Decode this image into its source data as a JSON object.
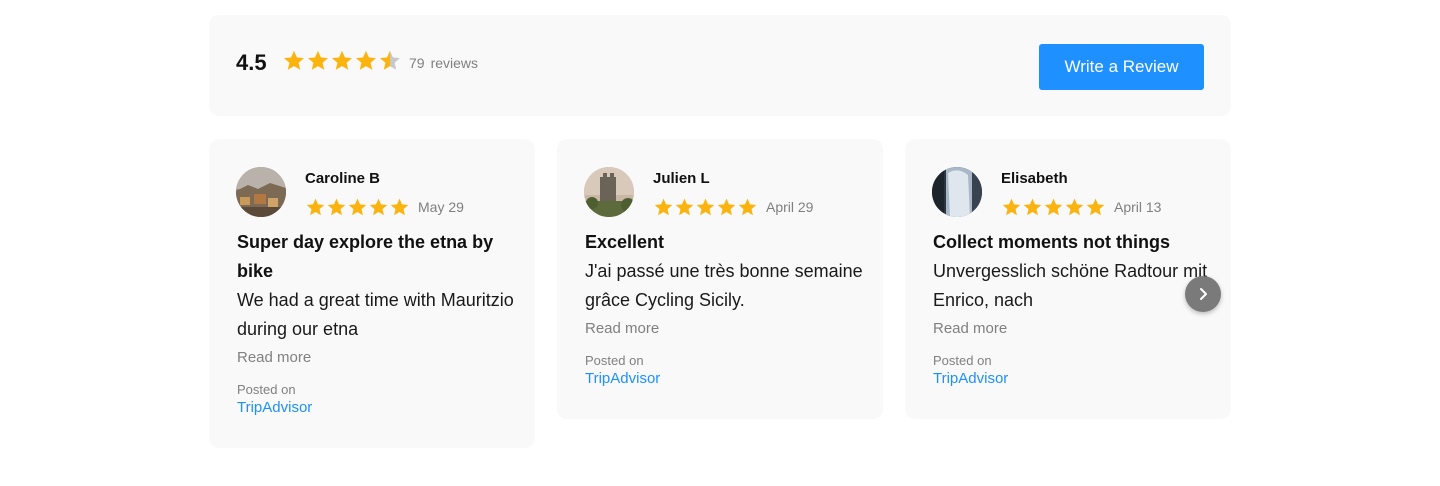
{
  "summary": {
    "average": "4.5",
    "rating_value": 4.5,
    "rating_max": 5,
    "review_count": "79",
    "reviews_label": "reviews",
    "write_button": "Write a Review"
  },
  "colors": {
    "star": "#fbb40f",
    "star_empty": "#c8c8c8",
    "accent": "#1e90ff",
    "card_bg": "#f9f9f9"
  },
  "reviews": [
    {
      "name": "Caroline B",
      "rating": 5,
      "date": "May 29",
      "title": "Super day explore the etna by bike",
      "text": "We had a great time with Mauritzio during our etna",
      "read_more": "Read more",
      "posted_label": "Posted on",
      "source": "TripAdvisor"
    },
    {
      "name": "Julien L",
      "rating": 5,
      "date": "April 29",
      "title": "Excellent",
      "text": "J'ai passé une très bonne semaine grâce Cycling Sicily.",
      "read_more": "Read more",
      "posted_label": "Posted on",
      "source": "TripAdvisor"
    },
    {
      "name": "Elisabeth",
      "rating": 5,
      "date": "April 13",
      "title": "Collect moments not things",
      "text": "Unvergesslich schöne Radtour mit Enrico, nach",
      "read_more": "Read more",
      "posted_label": "Posted on",
      "source": "TripAdvisor"
    }
  ],
  "icons": {
    "star": "star-icon",
    "next": "chevron-right-icon"
  }
}
